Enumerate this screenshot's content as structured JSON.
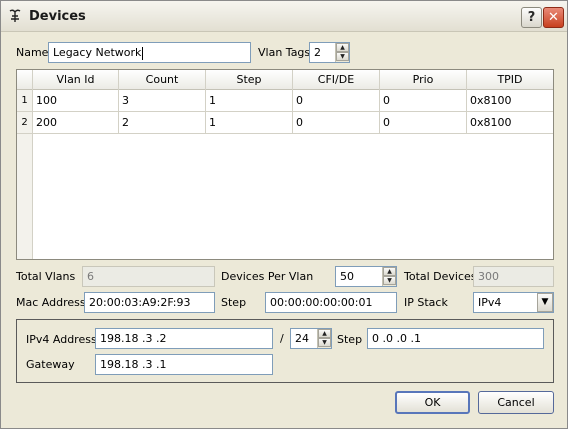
{
  "window": {
    "title": "Devices",
    "help_label": "?",
    "close_label": "✕"
  },
  "name_field": {
    "label": "Name",
    "value": "Legacy Network"
  },
  "vlan_tags": {
    "label": "Vlan Tags",
    "value": "2"
  },
  "vlan_table": {
    "columns": [
      "Vlan Id",
      "Count",
      "Step",
      "CFI/DE",
      "Prio",
      "TPID"
    ],
    "rows": [
      {
        "index": "1",
        "cells": [
          "100",
          "3",
          "1",
          "0",
          "0",
          "0x8100"
        ]
      },
      {
        "index": "2",
        "cells": [
          "200",
          "2",
          "1",
          "0",
          "0",
          "0x8100"
        ]
      }
    ]
  },
  "totals": {
    "total_vlans_label": "Total Vlans",
    "total_vlans_value": "6",
    "devices_per_vlan_label": "Devices Per Vlan",
    "devices_per_vlan_value": "50",
    "total_devices_label": "Total Devices",
    "total_devices_value": "300"
  },
  "mac": {
    "label": "Mac Address",
    "value": "20:00:03:A9:2F:93",
    "step_label": "Step",
    "step_value": "00:00:00:00:00:01",
    "ip_stack_label": "IP Stack",
    "ip_stack_value": "IPv4"
  },
  "ipv4": {
    "address_label": "IPv4 Address",
    "address_value": "198.18 .3  .2",
    "prefix_sep": "/",
    "prefix_value": "24",
    "step_label": "Step",
    "step_value": "0  .0  .0  .1",
    "gateway_label": "Gateway",
    "gateway_value": "198.18 .3  .1"
  },
  "buttons": {
    "ok": "OK",
    "cancel": "Cancel"
  },
  "icons": {
    "spin_up": "▲",
    "spin_down": "▼",
    "dropdown": "▼"
  },
  "colors": {
    "input_border": "#7f9db9",
    "close_button": "#c8401f",
    "default_button_border": "#5876ba"
  }
}
